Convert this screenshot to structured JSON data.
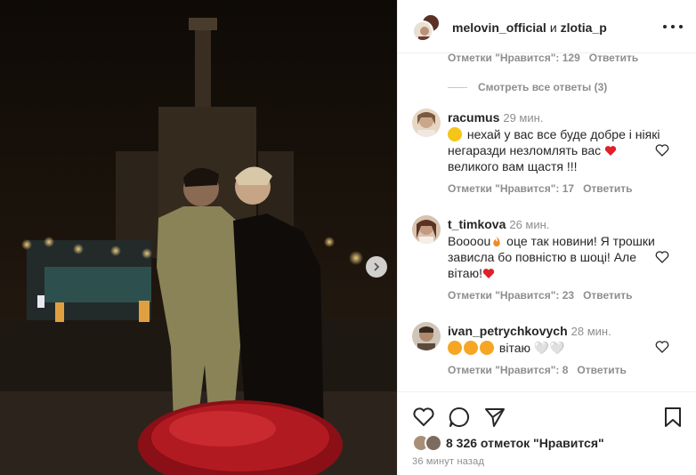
{
  "header": {
    "user1": "melovin_official",
    "conj": "и",
    "user2": "zlotia_p",
    "more_icon": "more-horizontal-icon"
  },
  "first_meta": {
    "likes": "Отметки \"Нравится\": 129",
    "reply": "Ответить"
  },
  "view_replies": "Смотреть все ответы (3)",
  "comments": [
    {
      "user": "racumus",
      "time": "29 мин.",
      "text": "нехай у вас все буде добре і ніякі негаразди незломлять вас",
      "text_end": "великого вам щастя !!!",
      "likes": "Отметки \"Нравится\": 17",
      "reply": "Ответить",
      "avatar_color": "#c9a78a"
    },
    {
      "user": "t_timkova",
      "time": "26 мин.",
      "text_a": "Boooou",
      "text_b": " оце так новини! Я трошки зависла бо повністю в шоці! Але вітаю!",
      "likes": "Отметки \"Нравится\": 23",
      "reply": "Ответить",
      "avatar_color": "#8a5a48"
    },
    {
      "user": "ivan_petrychkovych",
      "time": "28 мин.",
      "text": "вітаю ",
      "text_tail": "🤍🤍",
      "likes": "Отметки \"Нравится\": 8",
      "reply": "Ответить",
      "avatar_color": "#6b5a4c"
    }
  ],
  "likes_count": "8 326 отметок \"Нравится\"",
  "posted_ago": "36 минут назад",
  "colors": {
    "heart_red": "#ed4956",
    "meta_gray": "#8e8e8e",
    "border": "#efefef"
  }
}
